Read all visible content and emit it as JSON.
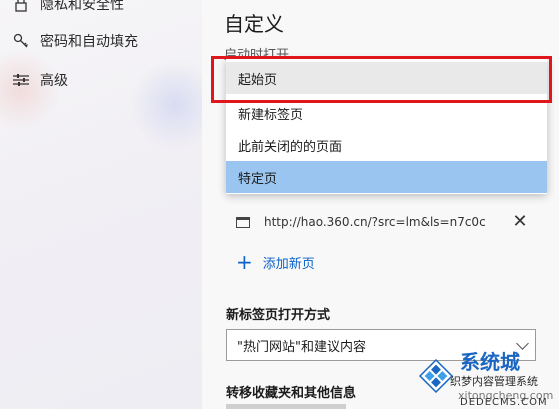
{
  "sidebar": {
    "items": [
      {
        "label": "隐私和安全性",
        "icon": "lock-icon"
      },
      {
        "label": "密码和自动填充",
        "icon": "key-icon"
      },
      {
        "label": "高级",
        "icon": "sliders-icon"
      }
    ]
  },
  "main": {
    "title": "自定义",
    "subtitle": "启动时打开",
    "dropdown": {
      "options": [
        "起始页",
        "新建标签页",
        "此前关闭的的页面",
        "特定页"
      ],
      "selected": "特定页",
      "hovered": "起始页"
    },
    "specific_page_url": "http://hao.360.cn/?src=lm&ls=n7c0cl",
    "add_page_label": "添加新页",
    "new_tab_section_label": "新标签页打开方式",
    "new_tab_select_value": "\"热门网站\"和建议内容",
    "favorites_section_label": "转移收藏夹和其他信息"
  },
  "watermark": {
    "brand": "系统城",
    "line1": "织梦内容管理系统",
    "line2": "xitongcheng.com",
    "line3": "DEDECMS.COM"
  },
  "colors": {
    "accent": "#0a61c9",
    "selected_option": "#9ac5f0",
    "annotation_red": "#e0161d"
  }
}
